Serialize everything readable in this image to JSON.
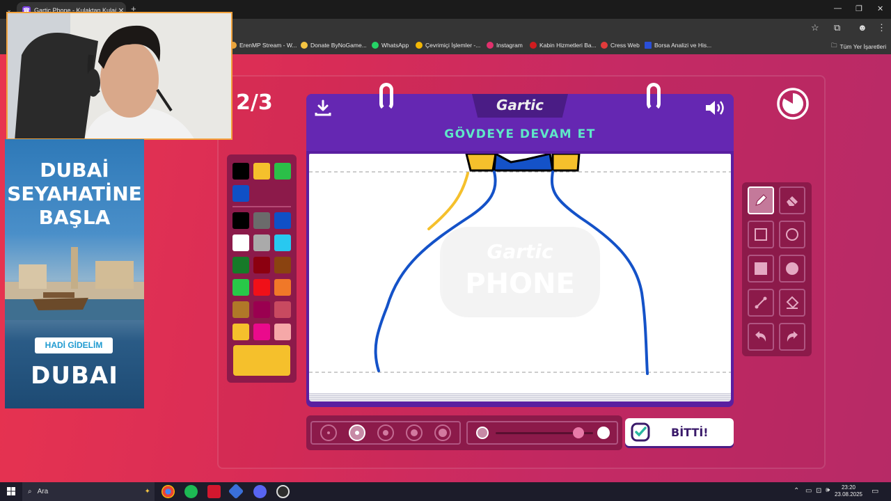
{
  "browser": {
    "tab_title": "Gartic Phone - Kulaktan Kulağa",
    "tab_icon": "gartic-icon",
    "new_tab": "+",
    "close_tab": "✕",
    "window": {
      "minimize": "—",
      "restore": "❐",
      "close": "✕"
    }
  },
  "bookmarks": [
    {
      "label": "ErenMP Stream - W...",
      "color": "#e9a43b"
    },
    {
      "label": "Donate ByNoGame...",
      "color": "#f5c542"
    },
    {
      "label": "WhatsApp",
      "color": "#25d366"
    },
    {
      "label": "Çevrimiçi İşlemler -...",
      "color": "#f2b705"
    },
    {
      "label": "Instagram",
      "color": "#e1306c"
    },
    {
      "label": "Kabin Hizmetleri Ba...",
      "color": "#d01c1f"
    },
    {
      "label": "Cress Web",
      "color": "#e23b3b"
    },
    {
      "label": "Borsa Analizi ve His...",
      "color": "#2a4fd8"
    }
  ],
  "all_bookmarks": "Tüm Yer İşaretleri",
  "game": {
    "round": "2/3",
    "logo": "Gartic",
    "prompt": "GÖVDEYE DEVAM ET",
    "watermark_top": "Gartic",
    "watermark_bottom": "PHONE",
    "done_button": "BİTTİ!",
    "palette_top": [
      "#000000",
      "#f5c02c",
      "#2bbf48",
      "#0f50c6"
    ],
    "palette_main": [
      "#000000",
      "#6b6b6b",
      "#0f50c6",
      "#ffffff",
      "#aaaaaa",
      "#28c8f0",
      "#167a28",
      "#8c0010",
      "#8a4310",
      "#28c848",
      "#f01018",
      "#f07828",
      "#b07828",
      "#9a0050",
      "#c84a60",
      "#f5c02c",
      "#ea0a8c",
      "#f5a8a8"
    ],
    "current_color": "#f5c02c",
    "tools": [
      {
        "name": "pencil-tool",
        "active": true
      },
      {
        "name": "eraser-tool",
        "active": false
      },
      {
        "name": "rectangle-tool",
        "active": false
      },
      {
        "name": "ellipse-tool",
        "active": false
      },
      {
        "name": "filled-rectangle-tool",
        "active": false
      },
      {
        "name": "filled-ellipse-tool",
        "active": false
      },
      {
        "name": "line-tool",
        "active": false
      },
      {
        "name": "fill-bucket-tool",
        "active": false
      },
      {
        "name": "undo-tool",
        "active": false
      },
      {
        "name": "redo-tool",
        "active": false
      }
    ],
    "brush_sizes": [
      1,
      2,
      3,
      4,
      5
    ],
    "selected_brush_size": 2,
    "opacity_level": 0.85
  },
  "ad": {
    "title_lines": [
      "DUBAİ",
      "SEYAHATİNE",
      "BAŞLA"
    ],
    "button": "HADİ GİDELİM",
    "brand": "DUBAI"
  },
  "taskbar": {
    "search_placeholder": "Ara",
    "time": "23:20",
    "date": "23.08.2025"
  }
}
